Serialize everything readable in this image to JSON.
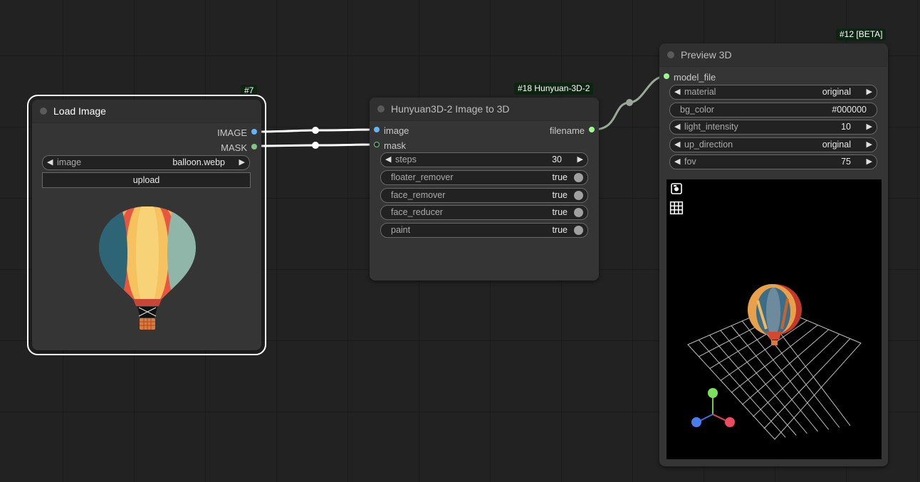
{
  "nodes": {
    "load_image": {
      "badge": "#7",
      "title": "Load Image",
      "outputs": [
        "IMAGE",
        "MASK"
      ],
      "image_widget": {
        "label": "image",
        "value": "balloon.webp"
      },
      "upload_label": "upload"
    },
    "hunyuan": {
      "badge": "#18 Hunyuan-3D-2",
      "title": "Hunyuan3D-2 Image to 3D",
      "inputs": [
        "image",
        "mask"
      ],
      "output": "filename",
      "steps": {
        "label": "steps",
        "value": "30"
      },
      "toggles": [
        {
          "label": "floater_remover",
          "value": "true"
        },
        {
          "label": "face_remover",
          "value": "true"
        },
        {
          "label": "face_reducer",
          "value": "true"
        },
        {
          "label": "paint",
          "value": "true"
        }
      ]
    },
    "preview3d": {
      "badge": "#12 [BETA]",
      "title": "Preview 3D",
      "input": "model_file",
      "widgets": {
        "material": {
          "label": "material",
          "value": "original"
        },
        "bg_color": {
          "label": "bg_color",
          "value": "#000000"
        },
        "light_intensity": {
          "label": "light_intensity",
          "value": "10"
        },
        "up_direction": {
          "label": "up_direction",
          "value": "original"
        },
        "fov": {
          "label": "fov",
          "value": "75"
        }
      },
      "icons": [
        "camera-icon",
        "grid-icon"
      ]
    }
  },
  "colors": {
    "canvas": "#222222",
    "node_body": "#353535",
    "image_slot": "#64b5f6",
    "mask_slot": "#81c784",
    "link_white": "#ffffff",
    "link_grey": "#a0b0a0",
    "badge": "#0d2412"
  }
}
